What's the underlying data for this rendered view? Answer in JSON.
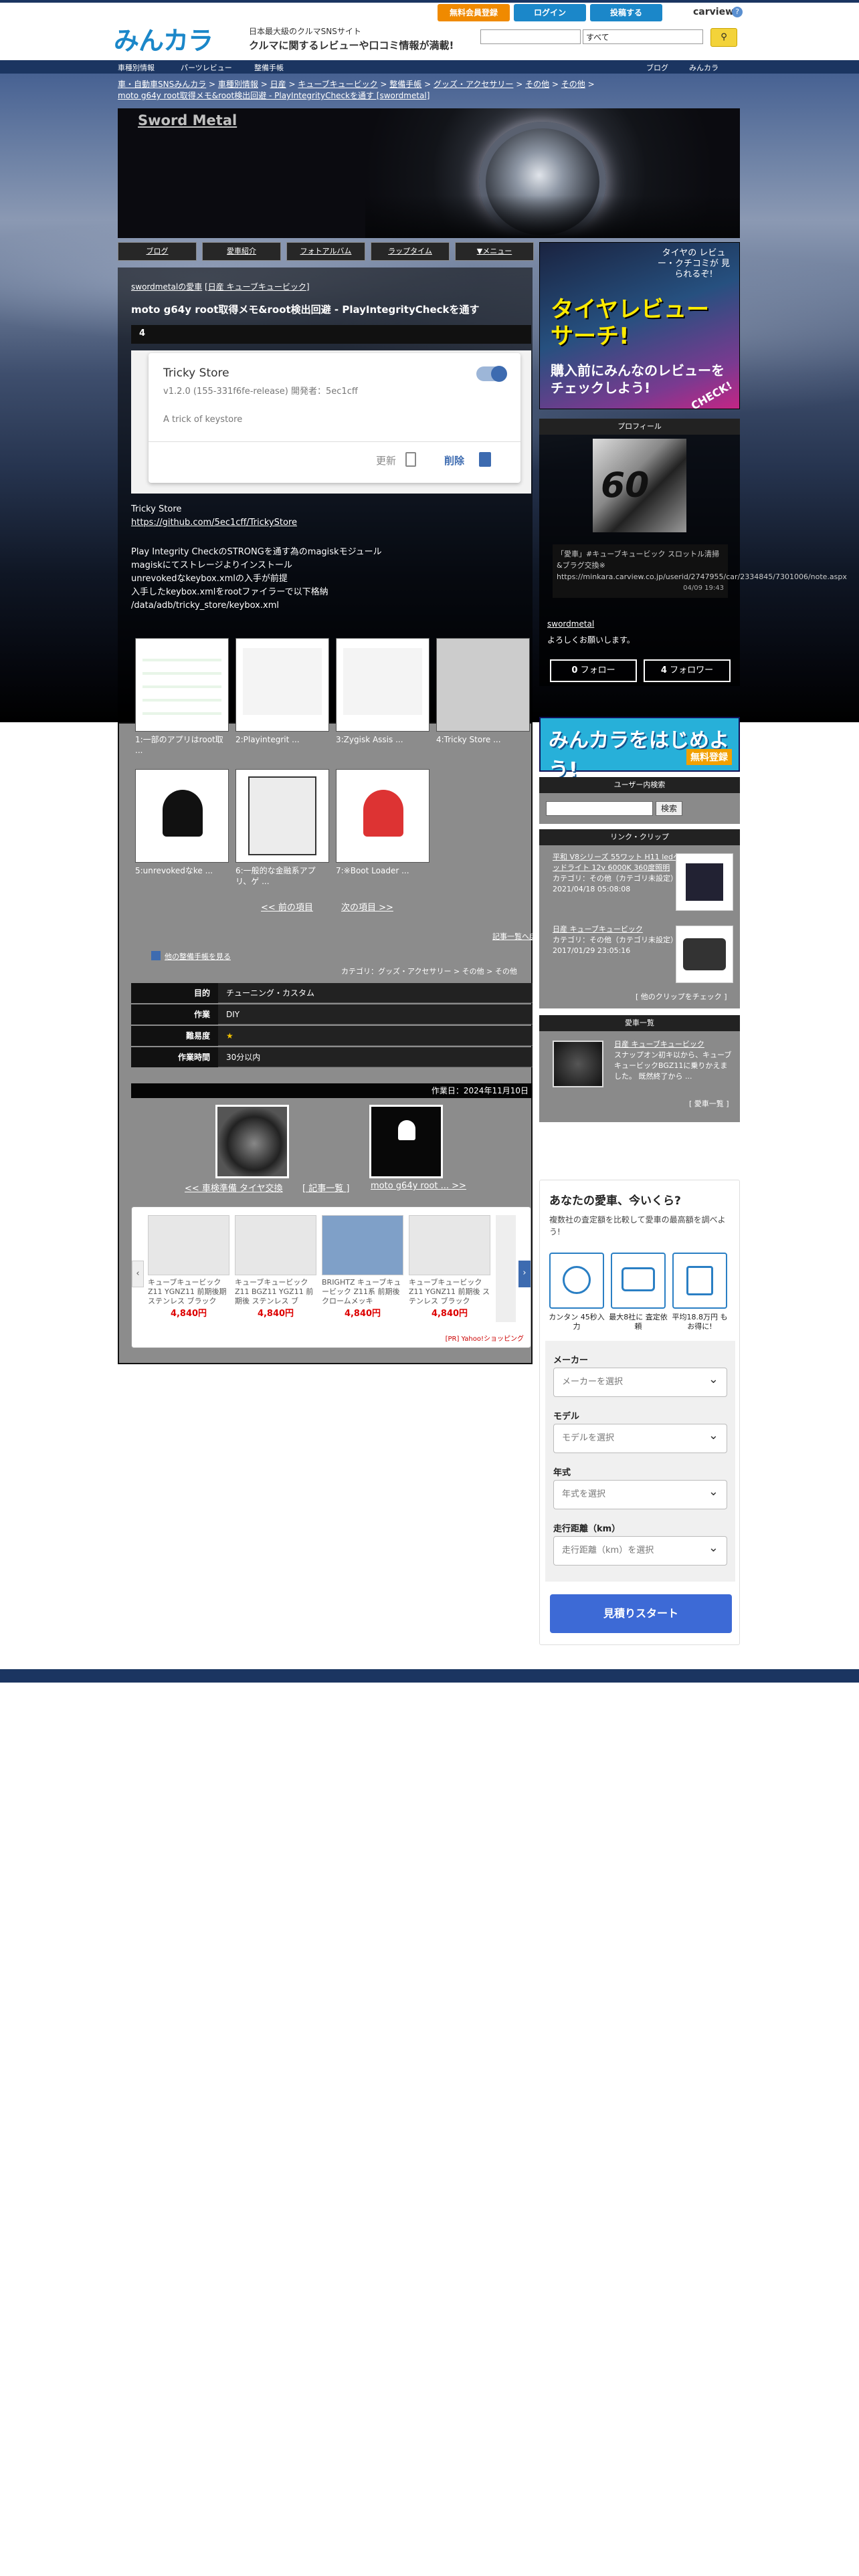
{
  "top": {
    "logo": "みんカラ",
    "tagline": "日本最大級のクルマSNSサイト",
    "tagline2": "クルマに関するレビューや口コミ情報が満載!",
    "register": "無料会員登録",
    "login": "ログイン",
    "post": "投稿する",
    "carview": "carview",
    "search_select": "すべて"
  },
  "nav": {
    "items": [
      "車種別情報",
      "パーツレビュー",
      "整備手帳"
    ],
    "right": [
      "ブログ",
      "みんカラ"
    ]
  },
  "breadcrumb": {
    "items": [
      "車・自動車SNSみんカラ",
      "車種別情報",
      "日産",
      "キューブキュービック",
      "整備手帳",
      "グッズ・アクセサリー",
      "その他",
      "その他"
    ],
    "current": "moto g64y root取得メモ&root検出回避 - PlayIntegrityCheckを通す [swordmetal]"
  },
  "header": {
    "title": "Sword Metal"
  },
  "tabs": [
    "ブログ",
    "愛車紹介",
    "フォトアルバム",
    "ラップタイム",
    "▼メニュー"
  ],
  "article": {
    "owner_prefix": "swordmetalの愛車",
    "owner_car": "日産 キューブキュービック",
    "title": "moto g64y root取得メモ&root検出回避 - PlayIntegrityCheckを通す",
    "step": "4",
    "app_name": "Tricky Store",
    "app_version": "v1.2.0 (155-331f6fe-release) 開発者：5ec1cff",
    "app_desc": "A trick of keystore",
    "app_update": "更新",
    "app_delete": "削除",
    "body_title": "Tricky Store",
    "body_link": "https://github.com/5ec1cff/TrickyStore",
    "body_text": "Play Integrity CheckのSTRONGを通す為のmagiskモジュール\nmagiskにてストレージよりインストール\nunrevokedなkeybox.xmlの入手が前提\n入手したkeybox.xmlをrootファイラーで以下格納\n/data/adb/tricky_store/keybox.xml"
  },
  "thumbs": [
    {
      "cap": "1:一部のアプリはroot取 ..."
    },
    {
      "cap": "2:Playintegrit ..."
    },
    {
      "cap": "3:Zygisk Assis ..."
    },
    {
      "cap": "4:Tricky Store ..."
    },
    {
      "cap": "5:unrevokedなke ..."
    },
    {
      "cap": "6:一般的な金融系アプリ、ゲ ..."
    },
    {
      "cap": "7:※Boot Loader ..."
    }
  ],
  "pager": {
    "prev": "<< 前の項目",
    "next": "次の項目 >>"
  },
  "actions": {
    "bookmark": "記事一覧へ戻る",
    "other": "他の整備手帳を見る",
    "category": "カテゴリ：グッズ・アクセサリー > その他 > その他"
  },
  "specs": [
    {
      "k": "目的",
      "v": "チューニング・カスタム"
    },
    {
      "k": "作業",
      "v": "DIY"
    },
    {
      "k": "難易度",
      "v": "★"
    },
    {
      "k": "作業時間",
      "v": "30分以内"
    }
  ],
  "workdate": "作業日：2024年11月10日",
  "nav_entries": {
    "prev": "<< 車検準備 タイヤ交換",
    "list": "[ 記事一覧 ]",
    "next": "moto g64y root ... >>"
  },
  "products": [
    {
      "name": "キューブキュービック Z11 YGNZ11 前期後期 ステンレス ブラック",
      "price": "4,840円"
    },
    {
      "name": "キューブキュービック Z11 BGZ11 YGZ11 前期後 ステンレス ブ",
      "price": "4,840円"
    },
    {
      "name": "BRIGHTZ キューブキュービック Z11系 前期後クロームメッキ",
      "price": "4,840円"
    },
    {
      "name": "キューブキュービック Z11 YGNZ11 前期後 ステンレス ブラック",
      "price": "4,840円"
    }
  ],
  "ad_label": "[PR] Yahoo!ショッピング",
  "side": {
    "banner_small": "タイヤの レビュー・クチコミが 見られるぞ!",
    "banner_big": "タイヤレビュー サーチ!",
    "banner_sub": "購入前にみんなのレビューをチェックしよう!",
    "banner_check": "CHECK!",
    "profile_head": "プロフィール",
    "profile_text": "「愛車」#キューブキュービック スロットル清掃&ブラグ交換※ https://minkara.carview.co.jp/userid/2747955/car/2334845/7301006/note.aspx",
    "profile_time": "04/09 19:43",
    "user_name": "swordmetal",
    "user_greet": "よろしくお願いします。",
    "follow": "フォロー",
    "follow_count": "0",
    "follower": "フォロワー",
    "follower_count": "4",
    "start_banner": "みんカラをはじめよう!",
    "start_badge": "無料登録",
    "user_search_head": "ユーザー内検索",
    "search_btn": "検索",
    "clip_head": "リンク・クリップ",
    "clips": [
      {
        "title": "平和 V8シリーズ 55ワット H11 ledヘッドライト 12v 6000K 360度照明",
        "cat": "カテゴリ：その他（カテゴリ未設定）",
        "date": "2021/04/18 05:08:08"
      },
      {
        "title": "日産 キューブキュービック",
        "cat": "カテゴリ：その他（カテゴリ未設定）",
        "date": "2017/01/29 23:05:16"
      }
    ],
    "clip_more": "[ 他のクリップをチェック ]",
    "car_head": "愛車一覧",
    "car_name": "日産 キューブキュービック",
    "car_desc": "スナップオン初キ以から、キューブキュービックBGZ11に乗りかえました。 既然終了から ...",
    "car_more": "[ 愛車一覧 ]"
  },
  "form": {
    "title": "あなたの愛車、今いくら?",
    "desc": "複数社の査定額を比較して愛車の最高額を調べよう!",
    "features": [
      "カンタン 45秒入力",
      "最大8社に 査定依頼",
      "平均18.8万円 もお得に!"
    ],
    "fields": [
      {
        "label": "メーカー",
        "placeholder": "メーカーを選択"
      },
      {
        "label": "モデル",
        "placeholder": "モデルを選択"
      },
      {
        "label": "年式",
        "placeholder": "年式を選択"
      },
      {
        "label": "走行距離（km）",
        "placeholder": "走行距離（km）を選択"
      }
    ],
    "submit": "見積りスタート"
  }
}
